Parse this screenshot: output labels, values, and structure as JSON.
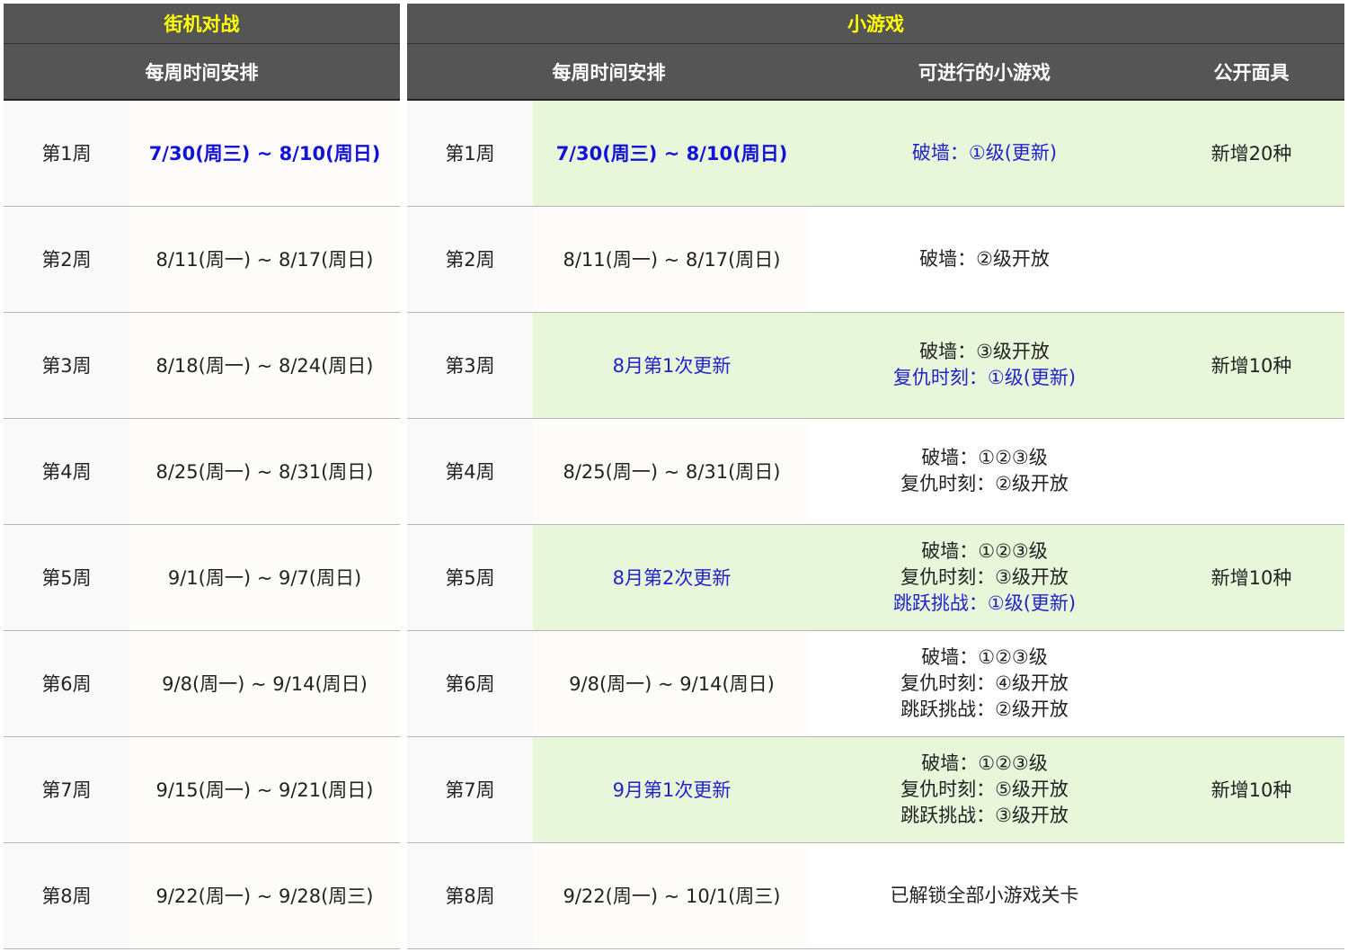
{
  "arcade": {
    "title": "街机对战",
    "col_schedule": "每周时间安排",
    "rows": [
      {
        "week": "第1周",
        "dates": "7/30(周三) ~ 8/10(周日)"
      },
      {
        "week": "第2周",
        "dates": "8/11(周一) ~ 8/17(周日)"
      },
      {
        "week": "第3周",
        "dates": "8/18(周一) ~ 8/24(周日)"
      },
      {
        "week": "第4周",
        "dates": "8/25(周一) ~ 8/31(周日)"
      },
      {
        "week": "第5周",
        "dates": "9/1(周一) ~ 9/7(周日)"
      },
      {
        "week": "第6周",
        "dates": "9/8(周一) ~ 9/14(周日)"
      },
      {
        "week": "第7周",
        "dates": "9/15(周一) ~ 9/21(周日)"
      },
      {
        "week": "第8周",
        "dates": "9/22(周一) ~ 9/28(周三)"
      }
    ]
  },
  "minigame": {
    "title": "小游戏",
    "col_schedule": "每周时间安排",
    "col_games": "可进行的小游戏",
    "col_masks": "公开面具",
    "rows": [
      {
        "week": "第1周",
        "dates": "7/30(周三) ~ 8/10(周日)",
        "games": [
          "破墙：①级(更新)"
        ],
        "masks": "新增20种"
      },
      {
        "week": "第2周",
        "dates": "8/11(周一) ~ 8/17(周日)",
        "games": [
          "破墙：②级开放"
        ],
        "masks": ""
      },
      {
        "week": "第3周",
        "dates": "8月第1次更新",
        "games": [
          "破墙：③级开放",
          "复仇时刻：①级(更新)"
        ],
        "masks": "新增10种"
      },
      {
        "week": "第4周",
        "dates": "8/25(周一) ~ 8/31(周日)",
        "games": [
          "破墙：①②③级",
          "复仇时刻：②级开放"
        ],
        "masks": ""
      },
      {
        "week": "第5周",
        "dates": "8月第2次更新",
        "games": [
          "破墙：①②③级",
          "复仇时刻：③级开放",
          "跳跃挑战：①级(更新)"
        ],
        "masks": "新增10种"
      },
      {
        "week": "第6周",
        "dates": "9/8(周一) ~ 9/14(周日)",
        "games": [
          "破墙：①②③级",
          "复仇时刻：④级开放",
          "跳跃挑战：②级开放"
        ],
        "masks": ""
      },
      {
        "week": "第7周",
        "dates": "9月第1次更新",
        "games": [
          "破墙：①②③级",
          "复仇时刻：⑤级开放",
          "跳跃挑战：③级开放"
        ],
        "masks": "新增10种"
      },
      {
        "week": "第8周",
        "dates": "9/22(周一) ~ 10/1(周三)",
        "games": [
          "已解锁全部小游戏关卡"
        ],
        "masks": ""
      }
    ]
  },
  "colors": {
    "header_bg": "#555555",
    "header_title": "#ffff00",
    "highlight_row_bg": "#e8f7da",
    "update_text": "#2222cc"
  }
}
